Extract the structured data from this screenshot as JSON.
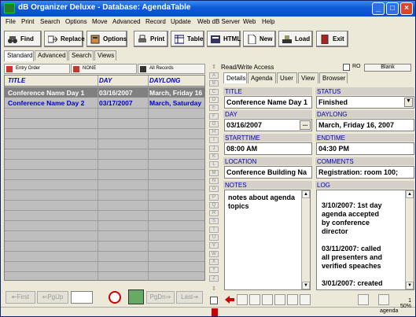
{
  "window": {
    "title": "dB Organizer Deluxe - Database: AgendaTable",
    "min_label": "_",
    "max_label": "□",
    "close_label": "×"
  },
  "menu": [
    "File",
    "Print",
    "Search",
    "Options",
    "Move",
    "Advanced",
    "Record",
    "Update",
    "Web dB Server",
    "Web",
    "Help"
  ],
  "toolbar": {
    "find": "Find",
    "replace": "Replace",
    "options": "Options",
    "print": "Print",
    "table": "Table",
    "html": "HTML",
    "new": "New",
    "load": "Load",
    "exit": "Exit"
  },
  "left_tabs": [
    "Standard",
    "Advanced",
    "Search",
    "Views"
  ],
  "sort": {
    "order": "Entry Order",
    "filter": "NONE",
    "records": "All Records"
  },
  "grid": {
    "columns": [
      "TITLE",
      "DAY",
      "DAYLONG"
    ],
    "rows": [
      [
        "Conference Name Day 1",
        "03/16/2007",
        "March, Friday 16"
      ],
      [
        "Conference Name Day 2",
        "03/17/2007",
        "March, Saturday"
      ]
    ]
  },
  "nav": {
    "first": "First",
    "pgup": "PgUp",
    "pgdn": "PgDn",
    "last": "Last"
  },
  "right": {
    "access": "Read/Write Access",
    "ro": "RO",
    "blank": "Blank",
    "tabs": [
      "Details",
      "Agenda",
      "User",
      "View",
      "Browser"
    ],
    "up_arrow": "⇧",
    "down_arrow": "⇩",
    "letters": [
      "A",
      "B",
      "C",
      "D",
      "E",
      "F",
      "G",
      "H",
      "I",
      "J",
      "K",
      "L",
      "M",
      "N",
      "O",
      "P",
      "Q",
      "R",
      "S",
      "T",
      "U",
      "V",
      "W",
      "X",
      "Y",
      "Z"
    ]
  },
  "form": {
    "title_label": "TITLE",
    "title_value": "Conference Name Day 1",
    "status_label": "STATUS",
    "status_value": "Finished",
    "day_label": "DAY",
    "day_value": "03/16/2007",
    "daylong_label": "DAYLONG",
    "daylong_value": "March, Friday 16, 2007",
    "starttime_label": "STARTTIME",
    "starttime_value": "08:00 AM",
    "endtime_label": "ENDTIME",
    "endtime_value": "04:30 PM",
    "location_label": "LOCATION",
    "location_value": "Conference Building Na",
    "comments_label": "COMMENTS",
    "comments_value": "Registration: room 100;",
    "notes_label": "NOTES",
    "notes_value": "notes about agenda topics",
    "log_label": "LOG",
    "log_lines": [
      "3/10/2007: 1st day",
      "agenda accepted",
      "by conference",
      "director",
      "",
      "03/11/2007: called",
      "all presenters and",
      "verified speaches",
      "",
      "3/01/2007: created"
    ]
  },
  "status": {
    "record_count": "1",
    "zoom": "50%",
    "user": "agenda"
  },
  "colors": {
    "header_text": "#0000CC",
    "selected_row": "#808080",
    "titlebar": "#0F5AD8"
  }
}
